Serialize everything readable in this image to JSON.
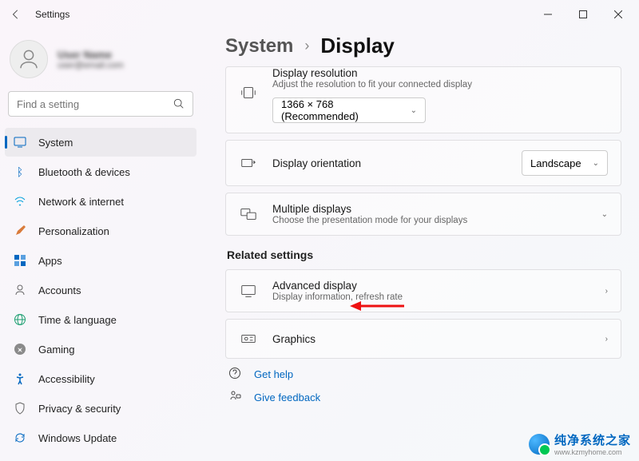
{
  "titlebar": {
    "title": "Settings"
  },
  "user": {
    "name": "User Name",
    "email": "user@email.com"
  },
  "search": {
    "placeholder": "Find a setting"
  },
  "nav": {
    "items": [
      {
        "label": "System"
      },
      {
        "label": "Bluetooth & devices"
      },
      {
        "label": "Network & internet"
      },
      {
        "label": "Personalization"
      },
      {
        "label": "Apps"
      },
      {
        "label": "Accounts"
      },
      {
        "label": "Time & language"
      },
      {
        "label": "Gaming"
      },
      {
        "label": "Accessibility"
      },
      {
        "label": "Privacy & security"
      },
      {
        "label": "Windows Update"
      }
    ]
  },
  "breadcrumb": {
    "parent": "System",
    "current": "Display"
  },
  "resolution": {
    "title": "Display resolution",
    "subtitle": "Adjust the resolution to fit your connected display",
    "value": "1366 × 768 (Recommended)"
  },
  "orientation": {
    "title": "Display orientation",
    "value": "Landscape"
  },
  "multiple": {
    "title": "Multiple displays",
    "subtitle": "Choose the presentation mode for your displays"
  },
  "related": {
    "heading": "Related settings"
  },
  "advanced": {
    "title": "Advanced display",
    "subtitle": "Display information, refresh rate"
  },
  "graphics": {
    "title": "Graphics"
  },
  "help": {
    "get": "Get help",
    "feedback": "Give feedback"
  },
  "watermark": {
    "line1": "纯净系统之家",
    "line2": "www.kzmyhome.com"
  }
}
